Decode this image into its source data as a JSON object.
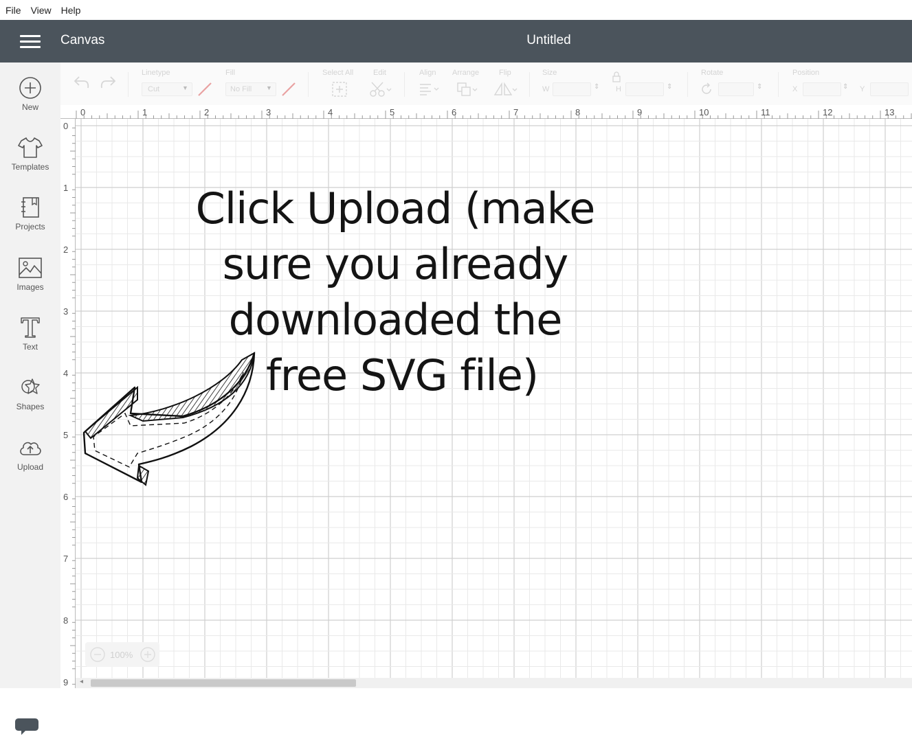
{
  "menu": {
    "items": [
      "File",
      "View",
      "Help"
    ]
  },
  "header": {
    "app_title": "Canvas",
    "doc_title": "Untitled"
  },
  "sidebar": {
    "items": [
      {
        "label": "New",
        "icon": "plus-circle-icon"
      },
      {
        "label": "Templates",
        "icon": "tshirt-icon"
      },
      {
        "label": "Projects",
        "icon": "notebook-icon"
      },
      {
        "label": "Images",
        "icon": "image-icon"
      },
      {
        "label": "Text",
        "icon": "text-T-icon"
      },
      {
        "label": "Shapes",
        "icon": "shapes-icon"
      },
      {
        "label": "Upload",
        "icon": "cloud-upload-icon"
      }
    ]
  },
  "toolbar": {
    "linetype_label": "Linetype",
    "linetype_value": "Cut",
    "fill_label": "Fill",
    "fill_value": "No Fill",
    "select_all_label": "Select All",
    "edit_label": "Edit",
    "align_label": "Align",
    "arrange_label": "Arrange",
    "flip_label": "Flip",
    "size_label": "Size",
    "size_w_label": "W",
    "size_h_label": "H",
    "rotate_label": "Rotate",
    "position_label": "Position",
    "position_x_label": "X",
    "position_y_label": "Y"
  },
  "ruler": {
    "top": [
      "0",
      "1",
      "2",
      "3",
      "4",
      "5",
      "6",
      "7",
      "8",
      "9",
      "10",
      "11",
      "12",
      "13"
    ],
    "left": [
      "0",
      "1",
      "2",
      "3",
      "4",
      "5",
      "6",
      "7",
      "8",
      "9"
    ]
  },
  "zoom": {
    "level": "100%"
  },
  "overlay": {
    "lines": [
      "Click Upload (make",
      "sure you already",
      "downloaded the",
      "free SVG file)"
    ]
  },
  "colors": {
    "header_bg": "#4b545c",
    "sidebar_bg": "#f2f2f2",
    "accent_red": "#e9a2a2"
  }
}
